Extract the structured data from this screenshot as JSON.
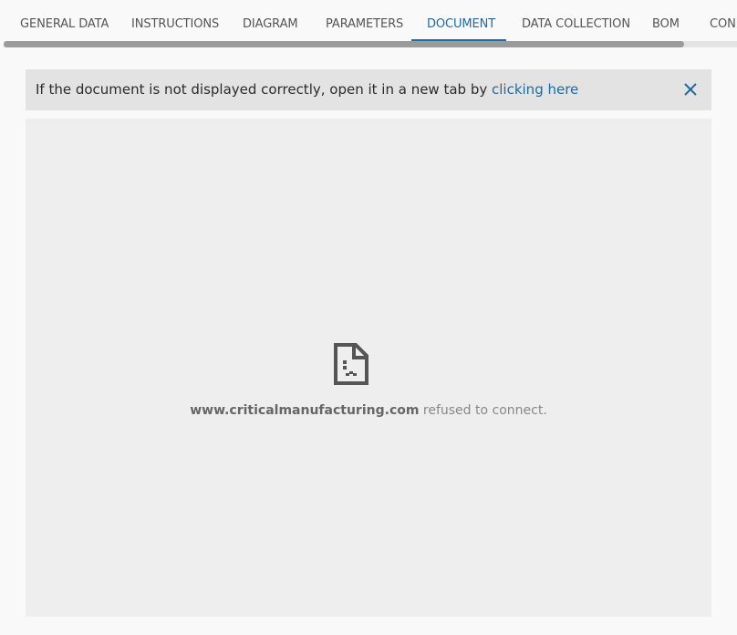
{
  "tabs": {
    "items": [
      {
        "label": "GENERAL DATA"
      },
      {
        "label": "INSTRUCTIONS"
      },
      {
        "label": "DIAGRAM"
      },
      {
        "label": "PARAMETERS"
      },
      {
        "label": "DOCUMENT"
      },
      {
        "label": "DATA COLLECTION"
      },
      {
        "label": "BOM"
      },
      {
        "label": "CON"
      }
    ],
    "active": "DOCUMENT"
  },
  "notice": {
    "text": "If the document is not displayed correctly, open it in a new tab by ",
    "link": "clicking here",
    "close_icon": "close-icon"
  },
  "frame": {
    "error_icon": "sad-document-icon",
    "host": "www.criticalmanufacturing.com",
    "message": " refused to connect."
  },
  "colors": {
    "accent": "#1f6aa0",
    "notice_bg": "#e3e3e3",
    "frame_bg": "#eeeeee"
  }
}
